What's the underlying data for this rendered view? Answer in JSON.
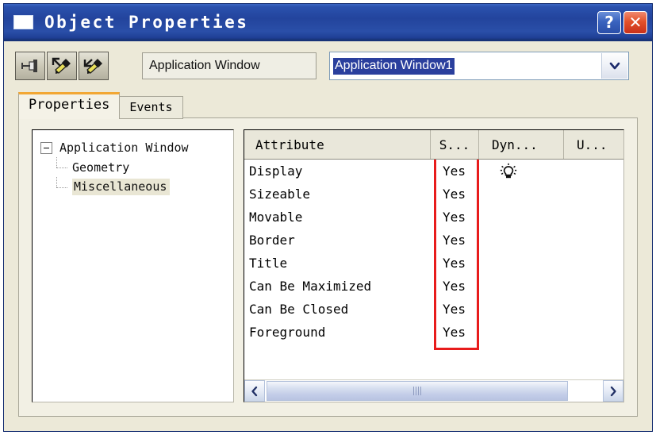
{
  "window": {
    "title": "Object Properties",
    "app_icon": "window-icon",
    "help_label": "?",
    "close_label": "✕",
    "titlebar_color": "#23449d",
    "close_color": "#c8301a"
  },
  "toolbar": {
    "buttons": [
      {
        "name": "pin-button",
        "icon": "pin-icon"
      },
      {
        "name": "pick-object-button",
        "icon": "eyedropper-up-icon"
      },
      {
        "name": "pick-parent-button",
        "icon": "eyedropper-down-icon"
      }
    ],
    "object_name_field": {
      "value": "Application Window",
      "placeholder": "Object name"
    },
    "object_combo": {
      "value": "Application Window1",
      "placeholder": "Select object",
      "selected_highlight": "#2a3f9d",
      "arrow_icon": "chevron-down-icon",
      "options": [
        "Application Window1"
      ]
    }
  },
  "tabs": [
    {
      "label": "Properties",
      "active": true
    },
    {
      "label": "Events",
      "active": false
    }
  ],
  "tab_accent_color": "#f2a734",
  "tree": {
    "root": {
      "label": "Application Window",
      "expanded": true,
      "expander_icon": "minus-box-icon"
    },
    "children": [
      {
        "label": "Geometry",
        "selected": false
      },
      {
        "label": "Miscellaneous",
        "selected": true
      }
    ],
    "selection_color": "#e9e6d4"
  },
  "grid": {
    "columns": [
      "Attribute",
      "S...",
      "Dyn...",
      "U..."
    ],
    "rows": [
      {
        "attribute": "Display",
        "s": "Yes",
        "dyn": "lightbulb-icon",
        "u": ""
      },
      {
        "attribute": "Sizeable",
        "s": "Yes",
        "dyn": "",
        "u": ""
      },
      {
        "attribute": "Movable",
        "s": "Yes",
        "dyn": "",
        "u": ""
      },
      {
        "attribute": "Border",
        "s": "Yes",
        "dyn": "",
        "u": ""
      },
      {
        "attribute": "Title",
        "s": "Yes",
        "dyn": "",
        "u": ""
      },
      {
        "attribute": "Can Be Maximized",
        "s": "Yes",
        "dyn": "",
        "u": ""
      },
      {
        "attribute": "Can Be Closed",
        "s": "Yes",
        "dyn": "",
        "u": ""
      },
      {
        "attribute": "Foreground",
        "s": "Yes",
        "dyn": "",
        "u": ""
      }
    ]
  },
  "annotation": {
    "shape": "rectangle",
    "color": "#e81c1c",
    "target_column": "S..."
  },
  "scrollbar": {
    "left_arrow": "chevron-left-icon",
    "right_arrow": "chevron-right-icon",
    "thumb_grip": "grip-icon"
  }
}
